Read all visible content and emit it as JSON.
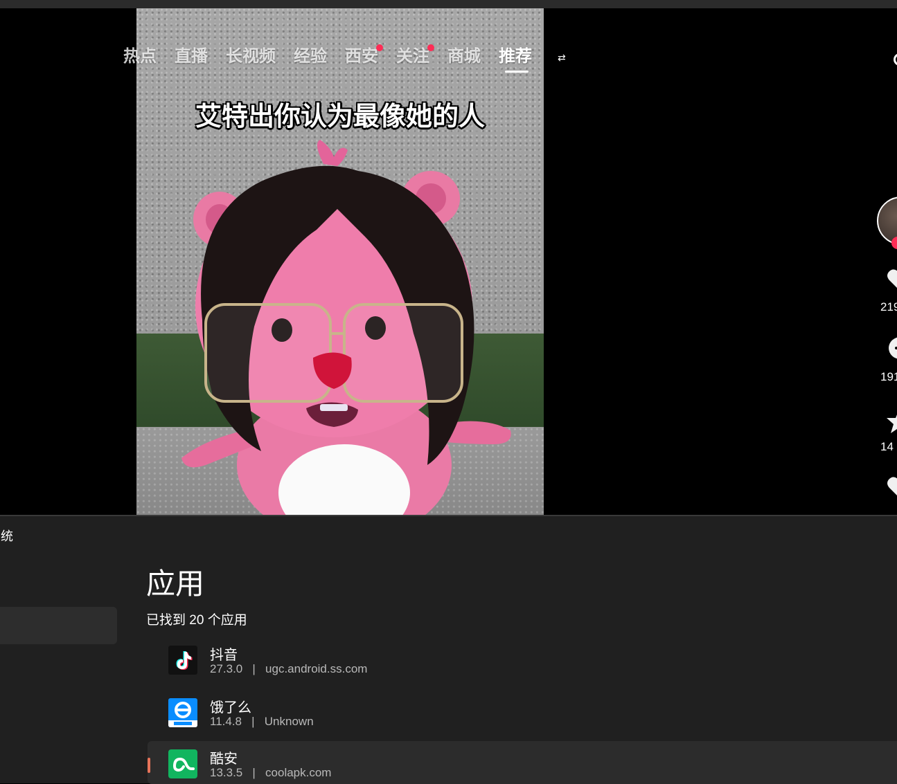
{
  "video_app": {
    "nav_tabs": [
      {
        "label": "热点",
        "dot": false
      },
      {
        "label": "直播",
        "dot": false
      },
      {
        "label": "长视频",
        "dot": false
      },
      {
        "label": "经验",
        "dot": false
      },
      {
        "label": "西安",
        "dot": true
      },
      {
        "label": "关注",
        "dot": true
      },
      {
        "label": "商城",
        "dot": false
      },
      {
        "label": "推荐",
        "dot": false,
        "active": true
      }
    ],
    "video_caption": "艾特出你认为最像她的人",
    "side_actions": {
      "like_count": "219",
      "comment_count": "191",
      "favorite_count": "14"
    },
    "accent_color": "#fe2c55"
  },
  "settings": {
    "window_title": "统",
    "page_title": "应用",
    "found_text": "已找到 20 个应用",
    "apps": [
      {
        "name": "抖音",
        "version": "27.3.0",
        "package": "ugc.android.ss.com",
        "icon": "douyin-icon"
      },
      {
        "name": "饿了么",
        "version": "11.4.8",
        "package": "Unknown",
        "icon": "eleme-icon"
      },
      {
        "name": "酷安",
        "version": "13.3.5",
        "package": "coolapk.com",
        "icon": "coolapk-icon",
        "selected": true
      }
    ],
    "selection_color": "#e8745a"
  }
}
